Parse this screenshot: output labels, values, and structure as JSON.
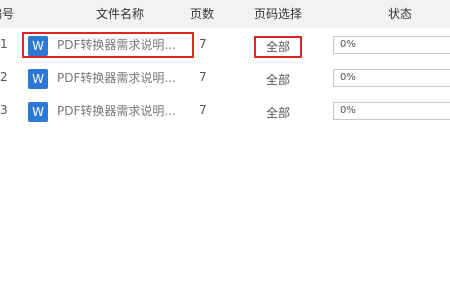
{
  "table": {
    "columns": {
      "index": "编号",
      "file_name": "文件名称",
      "pages": "页数",
      "page_range": "页码选择",
      "status": "状态"
    },
    "rows": [
      {
        "index": "1",
        "file_icon": "word-icon",
        "icon_letter": "W",
        "file_name": "PDF转换器需求说明...",
        "pages": "7",
        "page_range": "全部",
        "progress_text": "0%",
        "progress": 0
      },
      {
        "index": "2",
        "file_icon": "word-icon",
        "icon_letter": "W",
        "file_name": "PDF转换器需求说明...",
        "pages": "7",
        "page_range": "全部",
        "progress_text": "0%",
        "progress": 0
      },
      {
        "index": "3",
        "file_icon": "word-icon",
        "icon_letter": "W",
        "file_name": "PDF转换器需求说明...",
        "pages": "7",
        "page_range": "全部",
        "progress_text": "0%",
        "progress": 0
      }
    ]
  },
  "colors": {
    "header_bg": "#f2f2f2",
    "word_icon": "#2b78d6",
    "highlight_border": "#e02424"
  }
}
